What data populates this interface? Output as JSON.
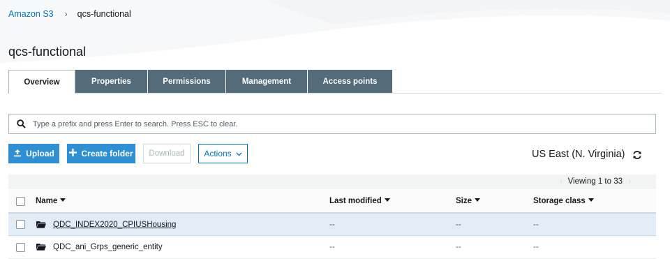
{
  "breadcrumb": {
    "root": "Amazon S3",
    "current": "qcs-functional"
  },
  "page_title": "qcs-functional",
  "tabs": [
    {
      "label": "Overview",
      "active": true
    },
    {
      "label": "Properties",
      "active": false
    },
    {
      "label": "Permissions",
      "active": false
    },
    {
      "label": "Management",
      "active": false
    },
    {
      "label": "Access points",
      "active": false
    }
  ],
  "search": {
    "placeholder": "Type a prefix and press Enter to search. Press ESC to clear.",
    "value": ""
  },
  "toolbar": {
    "upload_label": "Upload",
    "create_folder_label": "Create folder",
    "download_label": "Download",
    "actions_label": "Actions"
  },
  "region": "US East (N. Virginia)",
  "pagination": {
    "viewing": "Viewing 1 to 33"
  },
  "table": {
    "columns": [
      "Name",
      "Last modified",
      "Size",
      "Storage class"
    ],
    "rows": [
      {
        "name": "QDC_INDEX2020_CPIUSHousing",
        "last_modified": "--",
        "size": "--",
        "storage_class": "--",
        "type": "folder",
        "highlighted": true
      },
      {
        "name": "QDC_ani_Grps_generic_entity",
        "last_modified": "--",
        "size": "--",
        "storage_class": "--",
        "type": "folder",
        "highlighted": false
      }
    ]
  },
  "colors": {
    "accent": "#0073bb",
    "primary_button": "#2e8fd2",
    "tab_inactive": "#546b7a",
    "selected_row": "#e1ecf4"
  },
  "icons": [
    "search-icon",
    "upload-icon",
    "plus-icon",
    "chevron-down-icon",
    "refresh-icon",
    "folder-icon",
    "chevron-right-icon"
  ]
}
